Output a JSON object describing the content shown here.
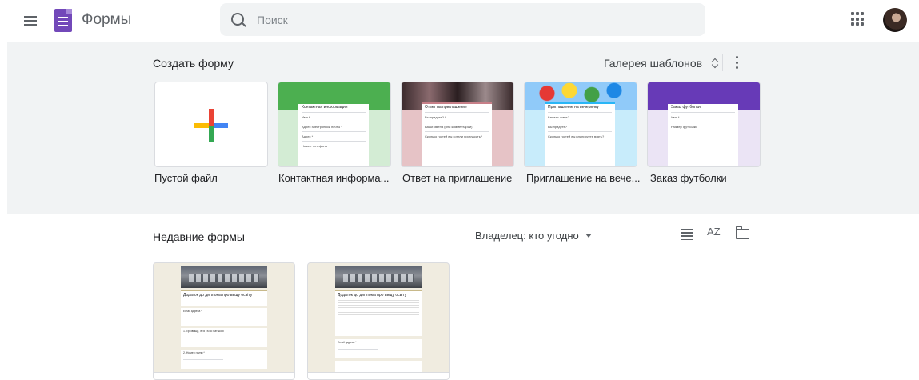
{
  "header": {
    "app_title": "Формы",
    "menu_icon": "hamburger-menu-icon",
    "search_placeholder": "Поиск",
    "apps_icon": "google-apps-grid-icon",
    "avatar": "user-avatar"
  },
  "templates": {
    "title": "Создать форму",
    "gallery_label": "Галерея шаблонов",
    "items": [
      {
        "label": "Пустой файл",
        "accent": "#ffffff"
      },
      {
        "label": "Контактная информа...",
        "accent": "#4caf50",
        "mini_title": "Контактная информация",
        "mini_fields": [
          "Имя *",
          "Адрес электронной почты *",
          "Адрес *",
          "Номер телефона"
        ]
      },
      {
        "label": "Ответ на приглашение",
        "accent": "#e0b4b8",
        "mini_title": "Ответ на приглашение",
        "mini_fields": [
          "Вы придете? *",
          "Ваши имена (или комментарии)",
          "Сколько гостей вы хотели пригласить?"
        ]
      },
      {
        "label": "Приглашение на вече...",
        "accent": "#81d4fa",
        "mini_title": "Приглашение на вечеринку",
        "mini_fields": [
          "Как вас зовут?",
          "Вы придете?",
          "Сколько гостей вы планируете взять?"
        ]
      },
      {
        "label": "Заказ футболки",
        "accent": "#673ab7",
        "mini_title": "Заказ футболки",
        "mini_fields": [
          "Имя *",
          "Размер футболки"
        ]
      }
    ]
  },
  "recent": {
    "title": "Недавние формы",
    "owner_filter": "Владелец: кто угодно",
    "sort_label": "AZ",
    "forms": [
      {
        "title": "Додаток до диплома про вищу освіту",
        "fields": [
          "Email адреса *",
          "1. Прізвище, ім'я та по батькові",
          "2. Номер групи *"
        ]
      },
      {
        "title": "Додаток до диплома про вищу освіту",
        "fields": [
          "Email адреса *"
        ]
      }
    ]
  }
}
